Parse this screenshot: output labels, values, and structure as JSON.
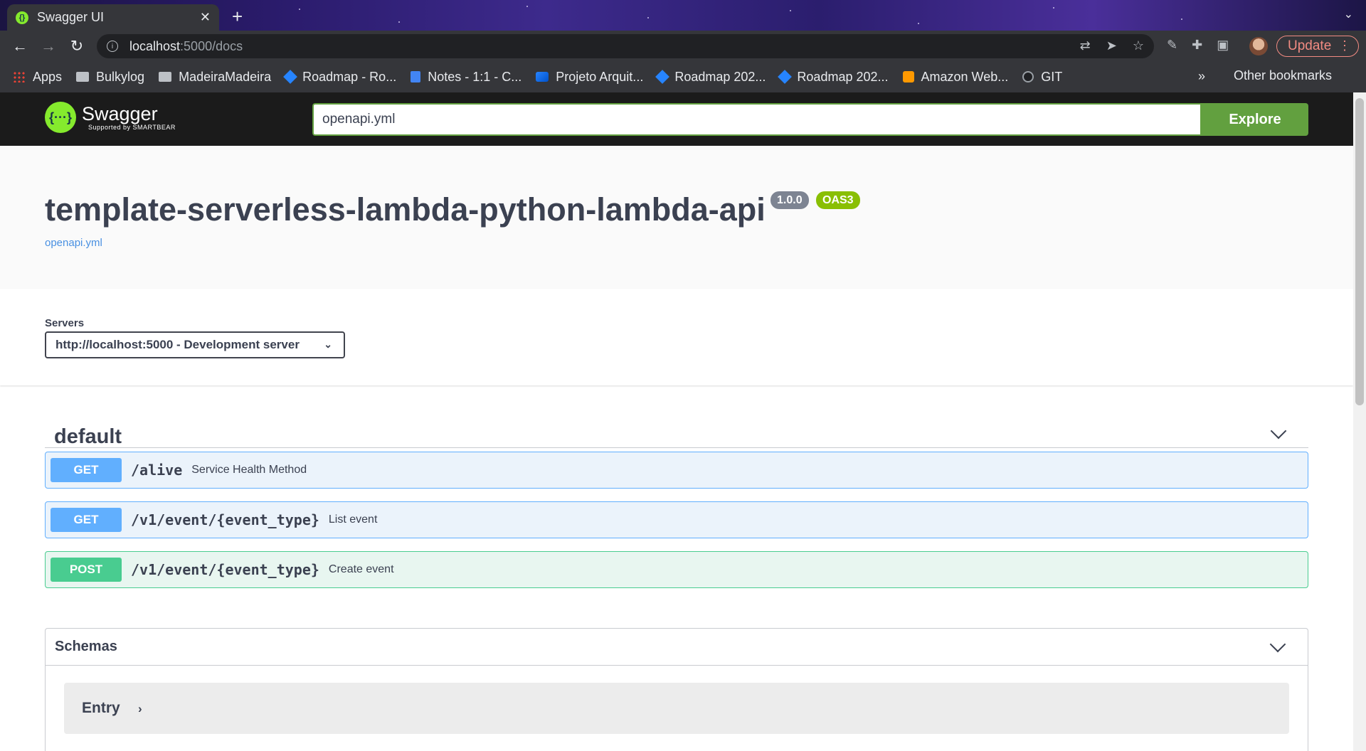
{
  "browser": {
    "tab_title": "Swagger UI",
    "url_host": "localhost",
    "url_path": ":5000/docs",
    "update_label": "Update",
    "bookmarks": [
      {
        "label": "Apps",
        "icon": "apps-icon"
      },
      {
        "label": "Bulkylog",
        "icon": "folder-icon"
      },
      {
        "label": "MadeiraMadeira",
        "icon": "folder-icon"
      },
      {
        "label": "Roadmap - Ro...",
        "icon": "jira-icon"
      },
      {
        "label": "Notes - 1:1 - C...",
        "icon": "docs-icon"
      },
      {
        "label": "Projeto Arquit...",
        "icon": "confluence-icon"
      },
      {
        "label": "Roadmap 202...",
        "icon": "jira-icon"
      },
      {
        "label": "Roadmap 202...",
        "icon": "jira-icon"
      },
      {
        "label": "Amazon Web...",
        "icon": "aws-icon"
      },
      {
        "label": "GIT",
        "icon": "github-icon"
      }
    ],
    "bookmarks_more": "»",
    "other_bookmarks": "Other bookmarks"
  },
  "swagger": {
    "logo_name": "Swagger",
    "logo_sub": "Supported by SMARTBEAR",
    "search_value": "openapi.yml",
    "explore_label": "Explore",
    "title": "template-serverless-lambda-python-lambda-api",
    "version": "1.0.0",
    "oas_badge": "OAS3",
    "spec_link": "openapi.yml",
    "servers_label": "Servers",
    "selected_server": "http://localhost:5000 - Development server",
    "tag_name": "default",
    "operations": [
      {
        "method": "GET",
        "path": "/alive",
        "summary": "Service Health Method"
      },
      {
        "method": "GET",
        "path": "/v1/event/{event_type}",
        "summary": "List event"
      },
      {
        "method": "POST",
        "path": "/v1/event/{event_type}",
        "summary": "Create event"
      }
    ],
    "schemas_title": "Schemas",
    "schemas": [
      {
        "name": "Entry"
      }
    ]
  },
  "colors": {
    "get": "#61affe",
    "post": "#49cc90",
    "swagger_green": "#62a03f",
    "topbar": "#1b1b1b"
  }
}
